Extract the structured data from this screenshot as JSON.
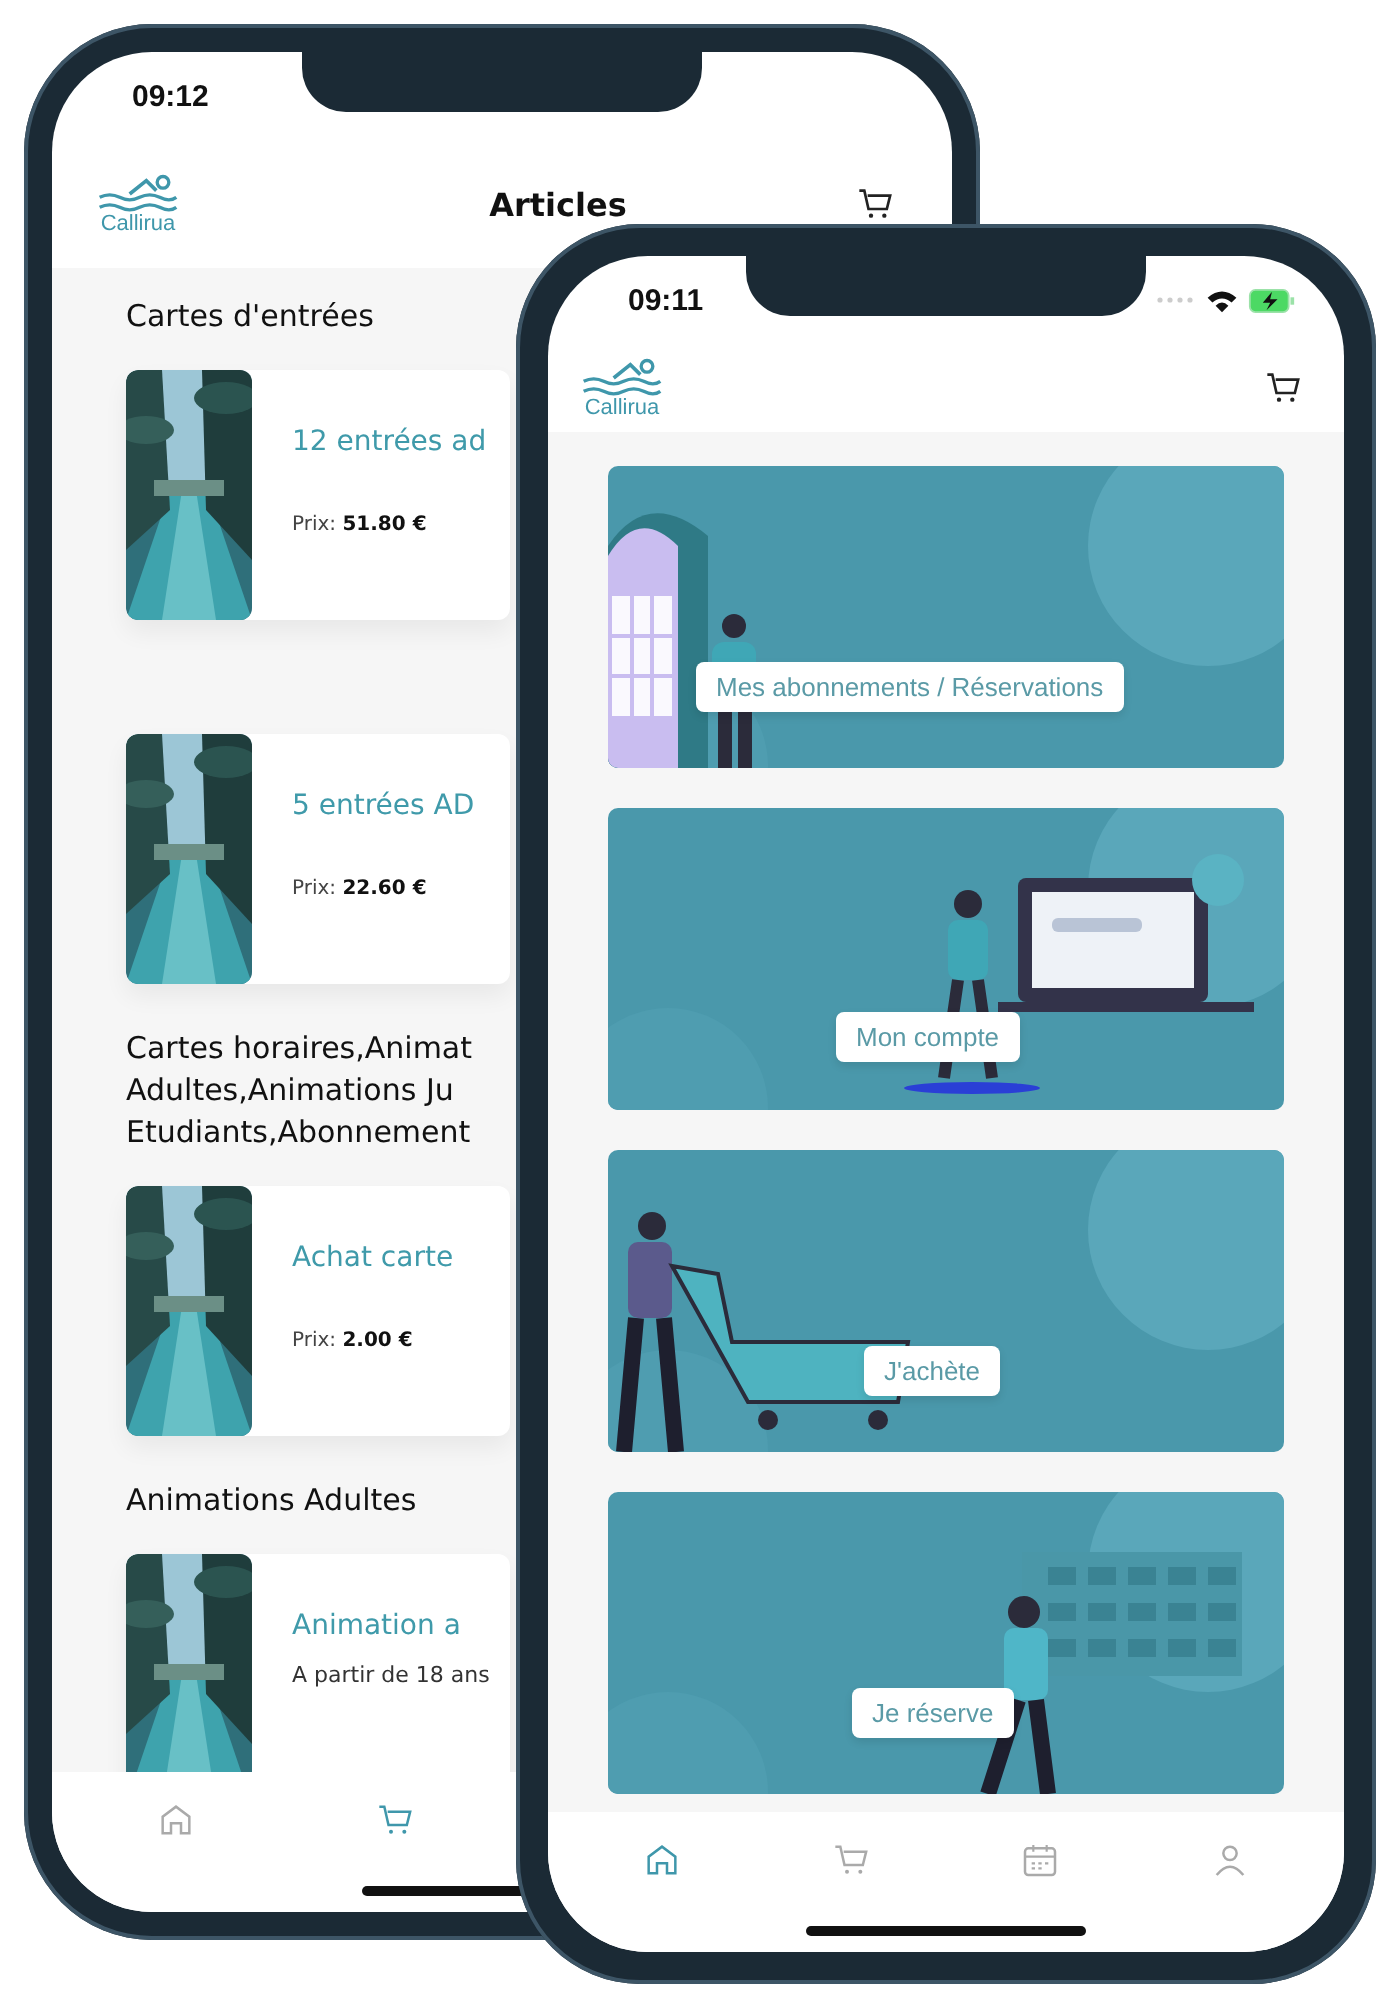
{
  "back_phone": {
    "status_bar": {
      "time": "09:12"
    },
    "header": {
      "logo": "Callirua",
      "title": "Articles"
    },
    "sections": [
      {
        "title_lines": [
          "Cartes d'entrées"
        ],
        "items": [
          {
            "name": "12 entrées ad",
            "price_label": "Prix:",
            "price": "51.80 €"
          },
          {
            "name": "5 entrées AD",
            "price_label": "Prix:",
            "price": "22.60 €"
          }
        ]
      },
      {
        "title_lines": [
          "Cartes horaires,Animat",
          "Adultes,Animations Ju",
          "Etudiants,Abonnement"
        ],
        "items": [
          {
            "name": "Achat carte",
            "price_label": "Prix:",
            "price": "2.00 €"
          }
        ]
      },
      {
        "title_lines": [
          "Animations Adultes"
        ],
        "items": [
          {
            "name": "Animation a",
            "subtitle": "A partir de 18 ans"
          }
        ]
      }
    ],
    "nav": [
      {
        "kind": "home",
        "selected": false
      },
      {
        "kind": "cart",
        "selected": true
      }
    ]
  },
  "front_phone": {
    "status_bar": {
      "time": "09:11"
    },
    "header": {
      "logo": "Callirua"
    },
    "banners": [
      {
        "kind": "door",
        "label": "Mes abonnements / Réservations"
      },
      {
        "kind": "laptop",
        "label": "Mon compte"
      },
      {
        "kind": "cart",
        "label": "J'achète"
      },
      {
        "kind": "calendar",
        "label": "Je réserve"
      }
    ],
    "nav": [
      {
        "kind": "home",
        "selected": true
      },
      {
        "kind": "cart",
        "selected": false
      },
      {
        "kind": "calendar",
        "selected": false
      },
      {
        "kind": "user",
        "selected": false
      }
    ]
  }
}
